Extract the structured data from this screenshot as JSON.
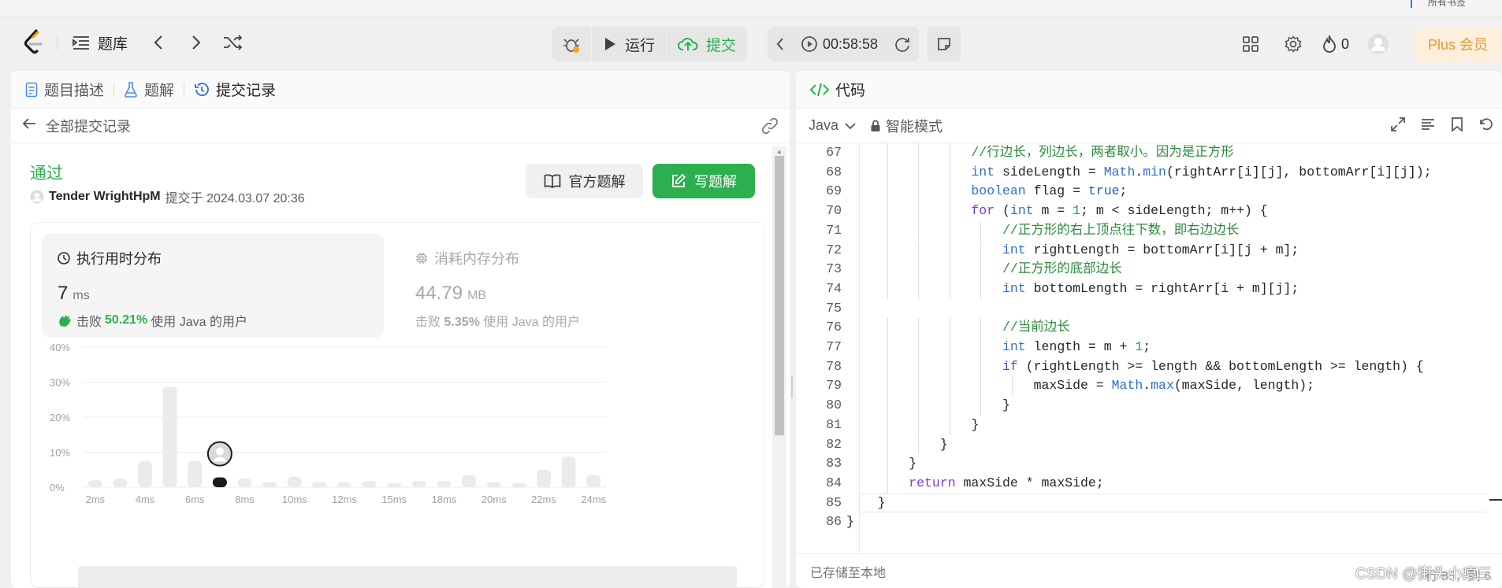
{
  "nav": {
    "tiku_label": "题库",
    "run_label": "运行",
    "submit_label": "提交",
    "timer": "00:58:58",
    "streak_count": "0",
    "plus_label": "Plus 会员"
  },
  "left_panel": {
    "tabs": [
      {
        "label": "题目描述",
        "icon": "document-icon"
      },
      {
        "label": "题解",
        "icon": "flask-icon"
      },
      {
        "label": "提交记录",
        "icon": "history-icon",
        "active": true
      }
    ],
    "back_label": "全部提交记录",
    "status": "通过",
    "username": "Tender WrightHpM",
    "submitted_text": "提交于 2024.03.07 20:36",
    "official_solution_label": "官方题解",
    "write_solution_label": "写题解",
    "runtime": {
      "title": "执行用时分布",
      "value": "7",
      "unit": "ms",
      "beat_prefix": "击败",
      "beat_pct": "50.21%",
      "beat_suffix": "使用 Java 的用户"
    },
    "memory": {
      "title": "消耗内存分布",
      "value": "44.79",
      "unit": "MB",
      "beat_prefix": "击败",
      "beat_pct": "5.35%",
      "beat_suffix": "使用 Java 的用户"
    }
  },
  "chart_data": {
    "type": "bar",
    "y_ticks": [
      "40%",
      "30%",
      "20%",
      "10%",
      "0%"
    ],
    "ylim": [
      0,
      40
    ],
    "x_ticks": [
      "2ms",
      "4ms",
      "6ms",
      "8ms",
      "10ms",
      "12ms",
      "15ms",
      "18ms",
      "20ms",
      "22ms",
      "24ms"
    ],
    "values": [
      2.0,
      2.5,
      7.5,
      28.7,
      7.5,
      2.8,
      2.5,
      1.5,
      3.0,
      1.5,
      1.5,
      1.7,
      1.3,
      1.8,
      1.8,
      3.5,
      1.5,
      1.3,
      5.0,
      8.8,
      3.5
    ],
    "highlight_index": 5,
    "bar_color": "#ebebeb",
    "highlight_color": "#1a1a1a"
  },
  "right_panel": {
    "tab_label": "代码",
    "language": "Java",
    "mode_label": "智能模式",
    "footer_label": "已存储至本地",
    "cursor_pos": "行 85，列 6",
    "code_lines": [
      {
        "n": "67",
        "indent": 4,
        "tokens": [
          [
            "cm",
            "//行边长，列边长，两者取小。因为是正方形"
          ]
        ]
      },
      {
        "n": "68",
        "indent": 4,
        "tokens": [
          [
            "ty",
            "int"
          ],
          [
            "",
            " sideLength = "
          ],
          [
            "cls",
            "Math"
          ],
          [
            "",
            "."
          ],
          [
            "cls",
            "min"
          ],
          [
            "",
            "(rightArr[i][j], bottomArr[i][j]);"
          ]
        ]
      },
      {
        "n": "69",
        "indent": 4,
        "tokens": [
          [
            "ty",
            "boolean"
          ],
          [
            "",
            " flag = "
          ],
          [
            "vl",
            "true"
          ],
          [
            "",
            ";"
          ]
        ]
      },
      {
        "n": "70",
        "indent": 4,
        "tokens": [
          [
            "kw",
            "for"
          ],
          [
            "",
            " ("
          ],
          [
            "ty",
            "int"
          ],
          [
            "",
            " m = "
          ],
          [
            "num",
            "1"
          ],
          [
            "",
            "; m < sideLength; m++) {"
          ]
        ]
      },
      {
        "n": "71",
        "indent": 5,
        "tokens": [
          [
            "cm",
            "//正方形的右上顶点往下数，即右边边长"
          ]
        ]
      },
      {
        "n": "72",
        "indent": 5,
        "tokens": [
          [
            "ty",
            "int"
          ],
          [
            "",
            " rightLength = bottomArr[i][j + m];"
          ]
        ]
      },
      {
        "n": "73",
        "indent": 5,
        "tokens": [
          [
            "cm",
            "//正方形的底部边长"
          ]
        ]
      },
      {
        "n": "74",
        "indent": 5,
        "tokens": [
          [
            "ty",
            "int"
          ],
          [
            "",
            " bottomLength = rightArr[i + m][j];"
          ]
        ]
      },
      {
        "n": "75",
        "indent": 0,
        "tokens": [
          [
            "",
            ""
          ]
        ]
      },
      {
        "n": "76",
        "indent": 5,
        "tokens": [
          [
            "cm",
            "//当前边长"
          ]
        ]
      },
      {
        "n": "77",
        "indent": 5,
        "tokens": [
          [
            "ty",
            "int"
          ],
          [
            "",
            " length = m + "
          ],
          [
            "num",
            "1"
          ],
          [
            "",
            ";"
          ]
        ]
      },
      {
        "n": "78",
        "indent": 5,
        "tokens": [
          [
            "kw",
            "if"
          ],
          [
            "",
            " (rightLength >= length && bottomLength >= length) {"
          ]
        ]
      },
      {
        "n": "79",
        "indent": 6,
        "tokens": [
          [
            "",
            "maxSide = "
          ],
          [
            "cls",
            "Math"
          ],
          [
            "",
            "."
          ],
          [
            "cls",
            "max"
          ],
          [
            "",
            "(maxSide, length);"
          ]
        ]
      },
      {
        "n": "80",
        "indent": 5,
        "tokens": [
          [
            "",
            "}"
          ]
        ]
      },
      {
        "n": "81",
        "indent": 4,
        "tokens": [
          [
            "",
            "}"
          ]
        ]
      },
      {
        "n": "82",
        "indent": 3,
        "tokens": [
          [
            "",
            "}"
          ]
        ]
      },
      {
        "n": "83",
        "indent": 2,
        "tokens": [
          [
            "",
            "}"
          ]
        ]
      },
      {
        "n": "84",
        "indent": 2,
        "tokens": [
          [
            "kw",
            "return"
          ],
          [
            "",
            " maxSide * maxSide;"
          ]
        ]
      },
      {
        "n": "85",
        "indent": 1,
        "tokens": [
          [
            "",
            "}"
          ]
        ],
        "current": true
      },
      {
        "n": "86",
        "indent": 0,
        "tokens": [
          [
            "",
            "}"
          ]
        ]
      }
    ]
  },
  "watermark": "CSDN @街头小瘪三",
  "corner_text": "所有书签"
}
